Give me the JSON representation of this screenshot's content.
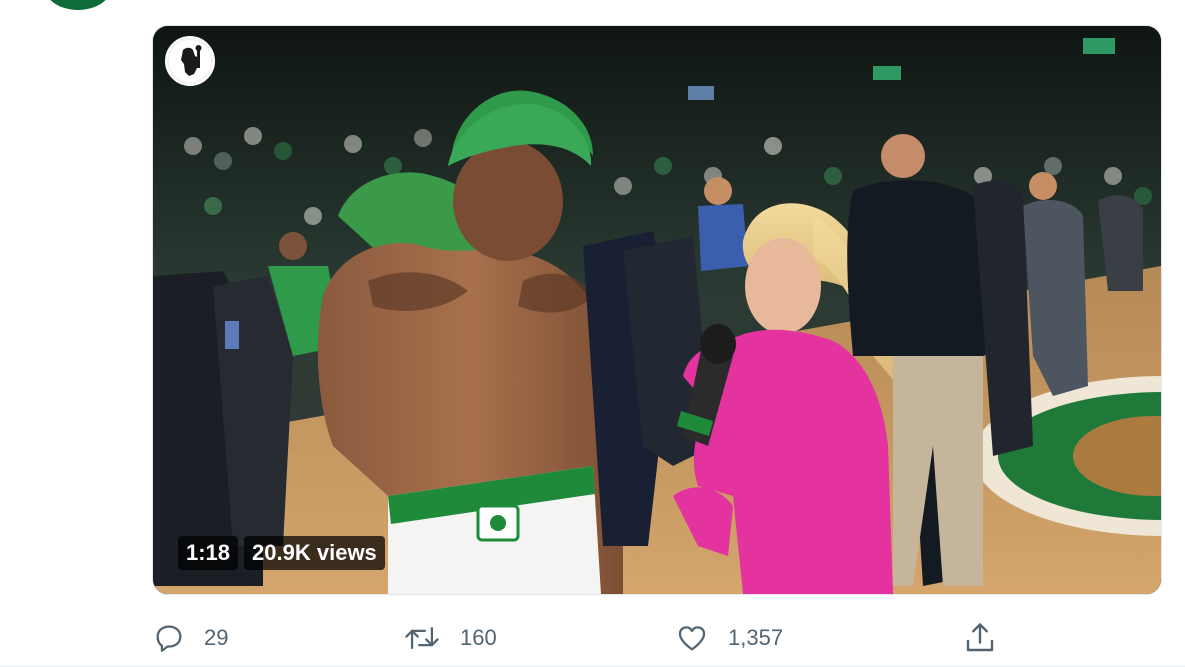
{
  "video": {
    "duration": "1:18",
    "views": "20.9K views"
  },
  "actions": {
    "reply": {
      "icon": "reply-icon",
      "count": "29"
    },
    "retweet": {
      "icon": "retweet-icon",
      "count": "160"
    },
    "like": {
      "icon": "heart-icon",
      "count": "1,357"
    },
    "share": {
      "icon": "share-icon"
    }
  },
  "colors": {
    "icon_gray": "#536471",
    "interviewer_dress": "#e4329f",
    "court_green": "#1f7a3a",
    "hair_green": "#2f9a4a"
  }
}
